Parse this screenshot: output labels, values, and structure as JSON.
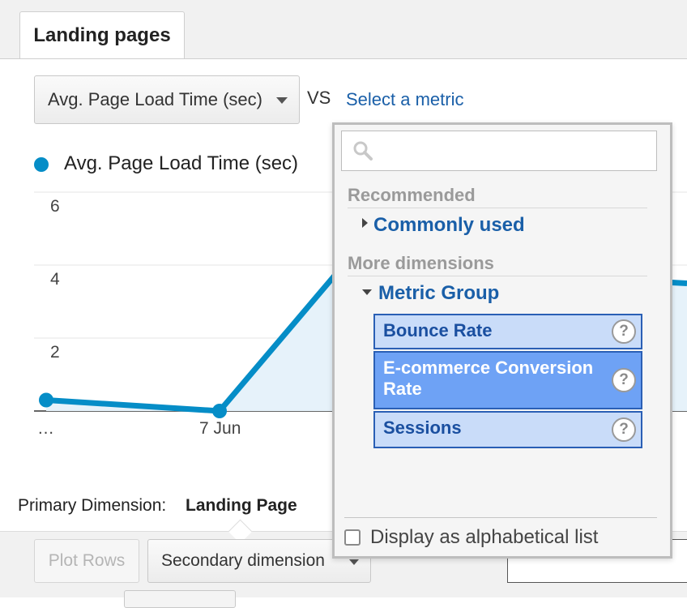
{
  "tabs": {
    "active_label": "Landing pages"
  },
  "metric_selector": {
    "value": "Avg. Page Load Time (sec)",
    "vs": "VS",
    "select_metric_link": "Select a metric"
  },
  "legend": {
    "label": "Avg. Page Load Time (sec)",
    "color": "#058dc7"
  },
  "chart_data": {
    "type": "area",
    "series": [
      {
        "name": "Avg. Page Load Time (sec)",
        "color": "#058dc7",
        "values": [
          0.3,
          0.0,
          4.0,
          3.5
        ]
      }
    ],
    "x": [
      "…",
      "7 Jun",
      "",
      ""
    ],
    "x_tick_labels": [
      "…",
      "7 Jun"
    ],
    "y_tick_labels": [
      "6",
      "4",
      "2"
    ],
    "ylim": [
      0,
      6
    ],
    "grid": true
  },
  "primary_dimension": {
    "label": "Primary Dimension:",
    "value": "Landing Page"
  },
  "toolbar": {
    "plot_rows": "Plot Rows",
    "secondary_dimension": "Secondary dimension"
  },
  "dropdown": {
    "search_placeholder": "",
    "sections": {
      "recommended": "Recommended",
      "commonly_used": "Commonly used",
      "more_dimensions": "More dimensions",
      "metric_group": "Metric Group"
    },
    "items": [
      {
        "label": "Bounce Rate",
        "help": "?"
      },
      {
        "label": "E-commerce Conversion Rate",
        "help": "?"
      },
      {
        "label": "Sessions",
        "help": "?"
      }
    ],
    "alphabetical_label": "Display as alphabetical list"
  }
}
